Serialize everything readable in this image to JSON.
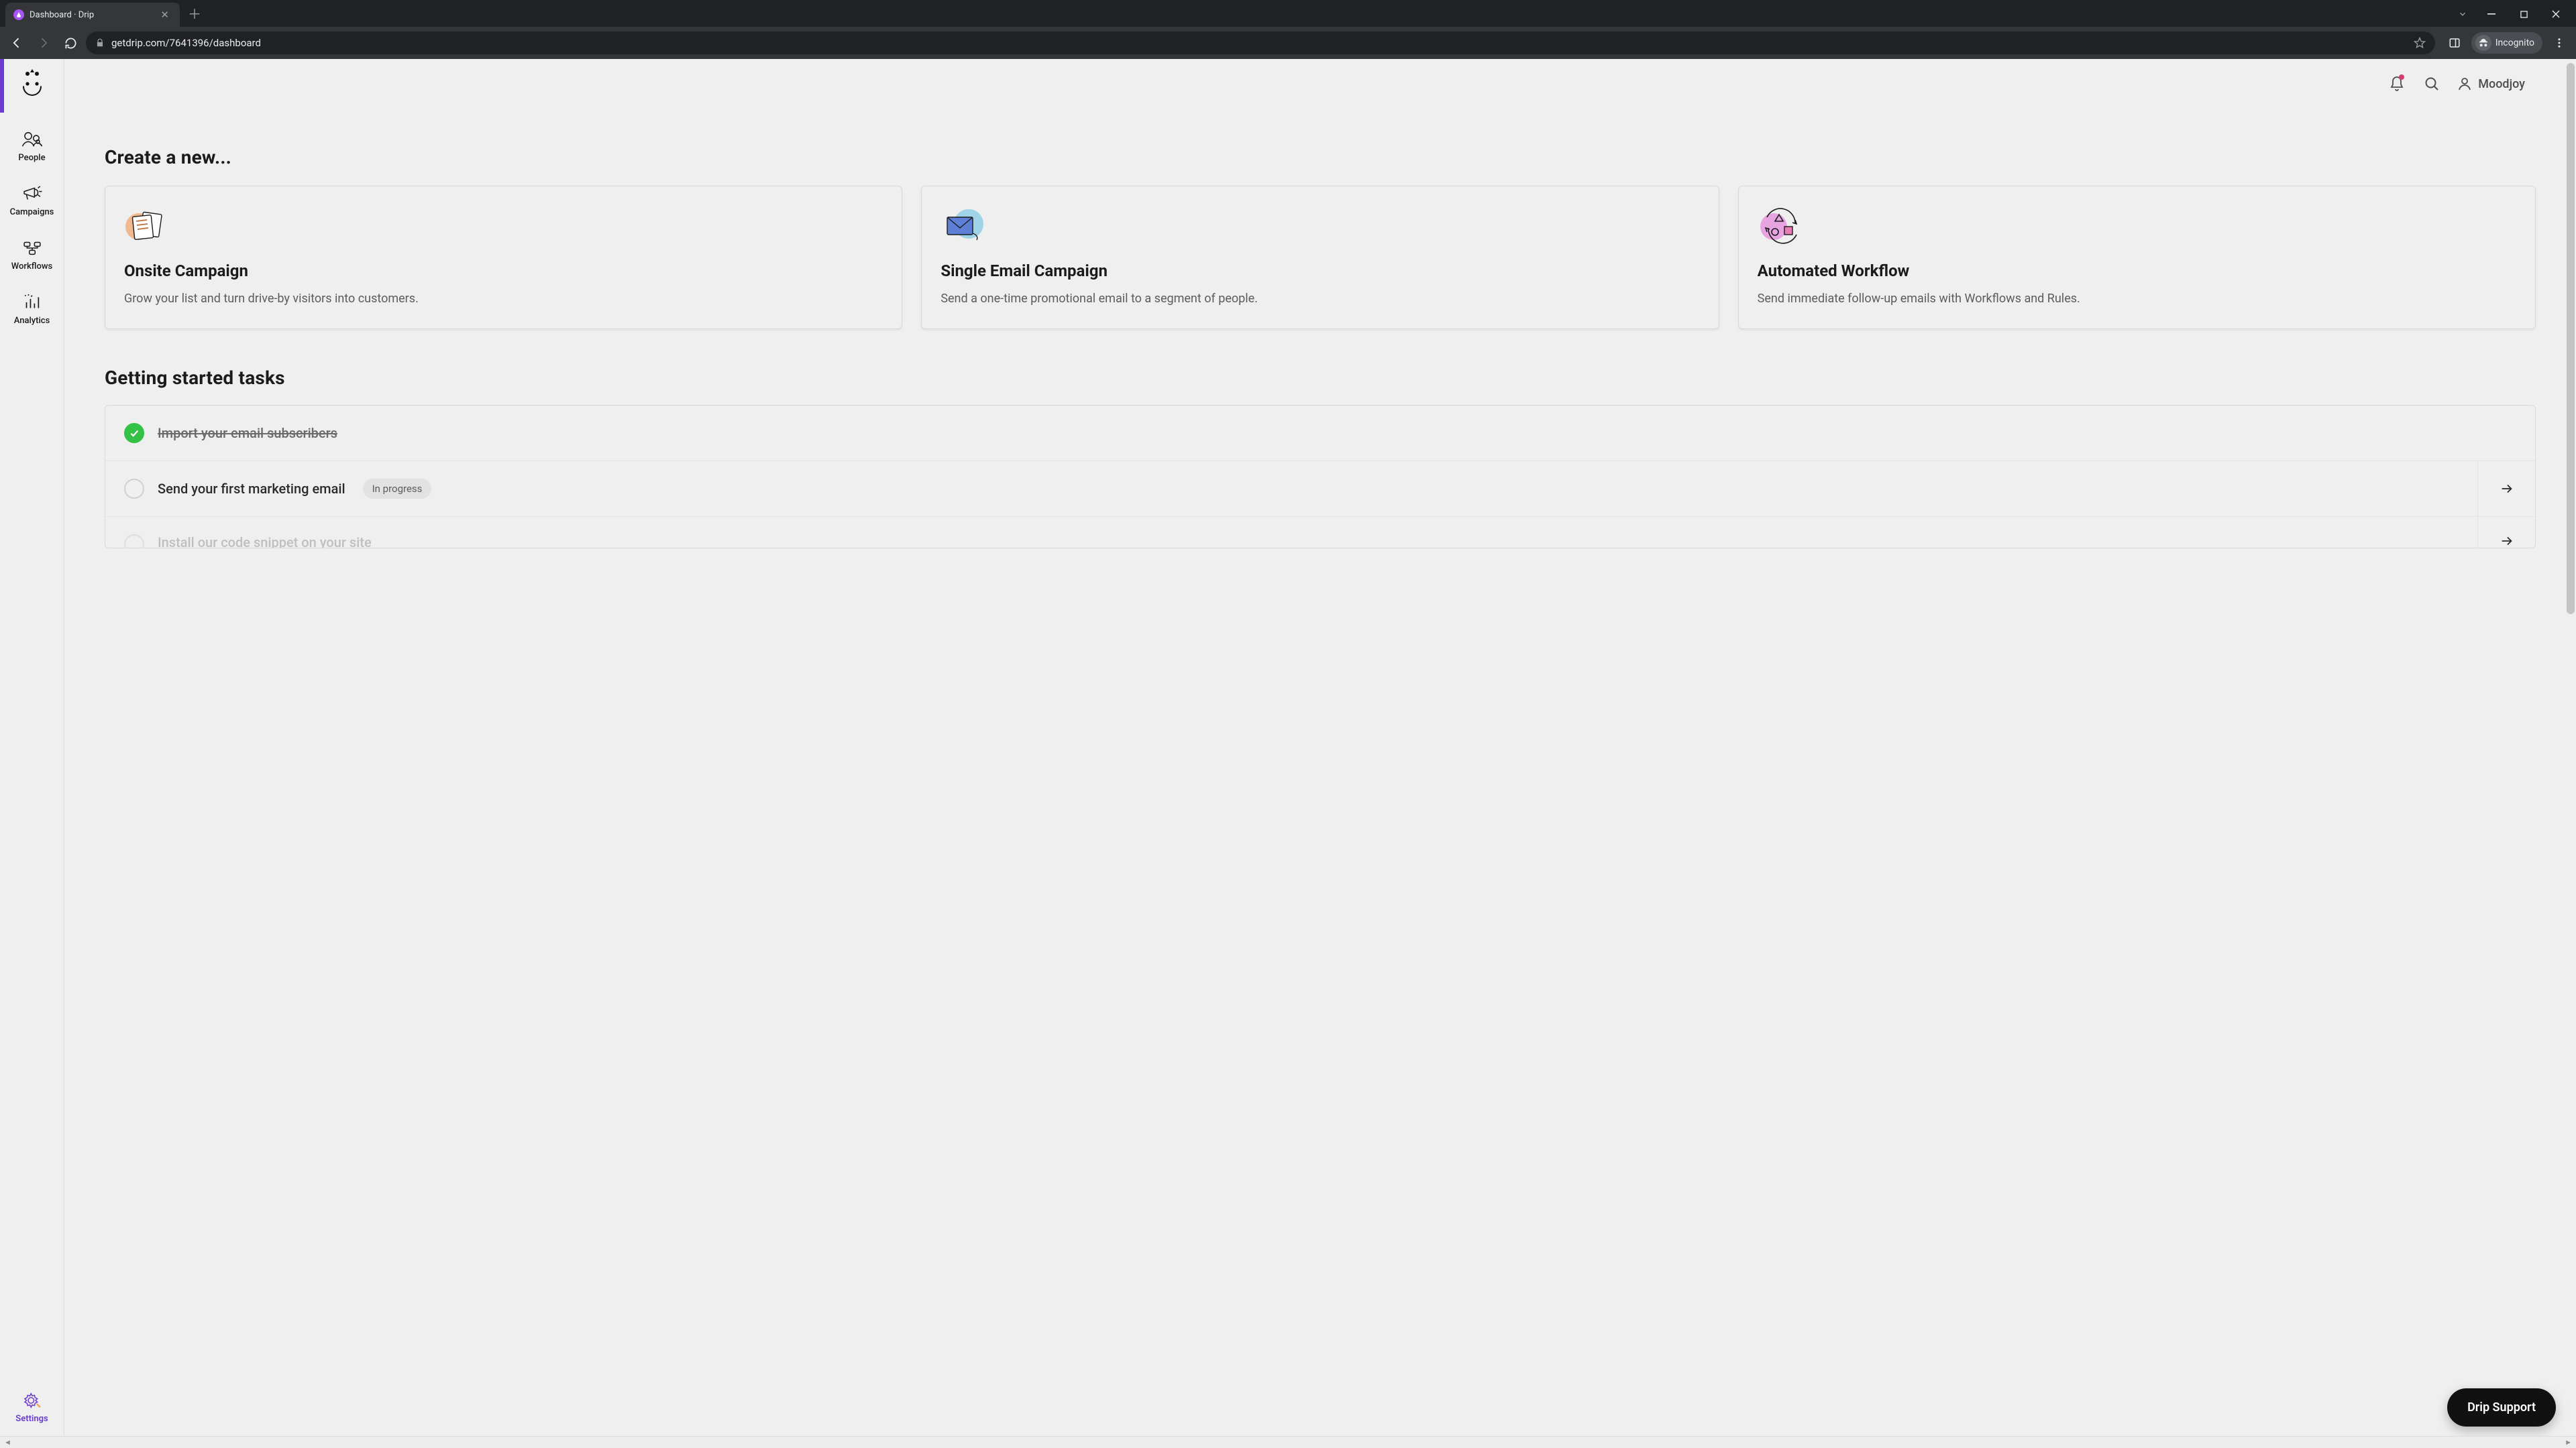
{
  "browser": {
    "tab_title": "Dashboard · Drip",
    "url": "getdrip.com/7641396/dashboard",
    "incognito_label": "Incognito"
  },
  "topbar": {
    "username": "Moodjoy"
  },
  "sidebar": {
    "items": [
      {
        "label": "People"
      },
      {
        "label": "Campaigns"
      },
      {
        "label": "Workflows"
      },
      {
        "label": "Analytics"
      }
    ],
    "settings_label": "Settings"
  },
  "create_section": {
    "heading": "Create a new...",
    "cards": [
      {
        "title": "Onsite Campaign",
        "desc": "Grow your list and turn drive-by visitors into customers."
      },
      {
        "title": "Single Email Campaign",
        "desc": "Send a one-time promotional email to a segment of people."
      },
      {
        "title": "Automated Workflow",
        "desc": "Send immediate follow-up emails with Workflows and Rules."
      }
    ]
  },
  "tasks_section": {
    "heading": "Getting started tasks",
    "items": [
      {
        "label": "Import your email subscribers",
        "status": "done"
      },
      {
        "label": "Send your first marketing email",
        "status": "in_progress",
        "badge": "In progress"
      },
      {
        "label": "Install our code snippet on your site",
        "status": "todo"
      }
    ]
  },
  "support_label": "Drip Support"
}
